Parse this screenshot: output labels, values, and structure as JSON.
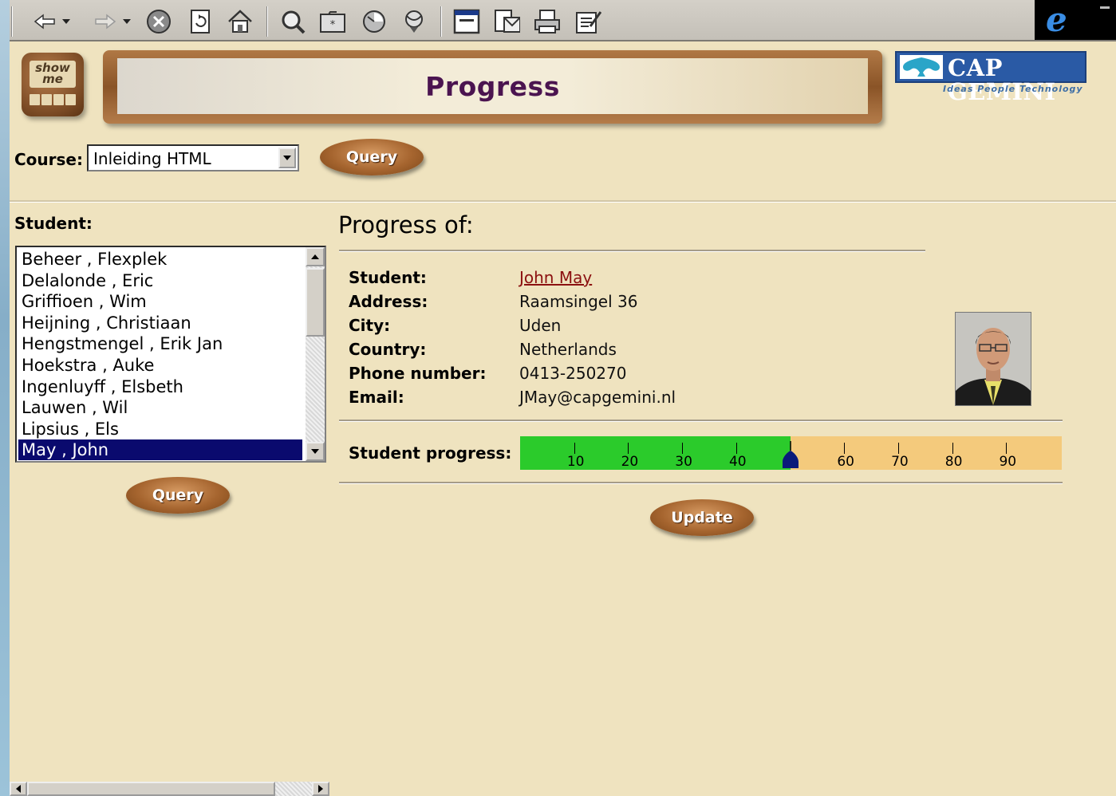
{
  "toolbar": {
    "icons": [
      "back-icon",
      "back-dropdown-icon",
      "forward-icon",
      "forward-dropdown-icon",
      "stop-icon",
      "refresh-icon",
      "home-icon",
      "search-icon",
      "favorites-icon",
      "history-icon",
      "channels-icon",
      "fullscreen-icon",
      "mail-icon",
      "print-icon",
      "edit-icon"
    ]
  },
  "header": {
    "show_me_line1": "show",
    "show_me_line2": "me",
    "title": "Progress",
    "logo_name": "CAP GEMINI",
    "logo_tagline": "Ideas People Technology"
  },
  "course": {
    "label": "Course:",
    "selected": "Inleiding HTML",
    "query_button": "Query"
  },
  "students": {
    "label": "Student:",
    "items": [
      "Beheer , Flexplek",
      "Delalonde , Eric",
      "Griffioen , Wim",
      "Heijning , Christiaan",
      "Hengstmengel , Erik Jan",
      "Hoekstra , Auke",
      "Ingenluyff , Elsbeth",
      "Lauwen , Wil",
      "Lipsius , Els",
      "May , John"
    ],
    "selected_index": 9,
    "query_button": "Query"
  },
  "detail": {
    "heading": "Progress of:",
    "student_label": "Student:",
    "student_value": "John May",
    "address_label": "Address:",
    "address_value": "Raamsingel 36",
    "city_label": "City:",
    "city_value": "Uden",
    "country_label": "Country:",
    "country_value": "Netherlands",
    "phone_label": "Phone number:",
    "phone_value": "0413-250270",
    "email_label": "Email:",
    "email_value": "JMay@capgemini.nl"
  },
  "progress": {
    "label": "Student progress:",
    "value_percent": 50,
    "ticks": [
      "10",
      "20",
      "30",
      "40",
      "60",
      "70",
      "80",
      "90"
    ],
    "tick_values": [
      10,
      20,
      30,
      40,
      60,
      70,
      80,
      90
    ],
    "colors": {
      "done": "#2bcb2b",
      "remaining": "#f4ca7c",
      "marker": "#0a1a7a"
    }
  },
  "update_button": "Update"
}
